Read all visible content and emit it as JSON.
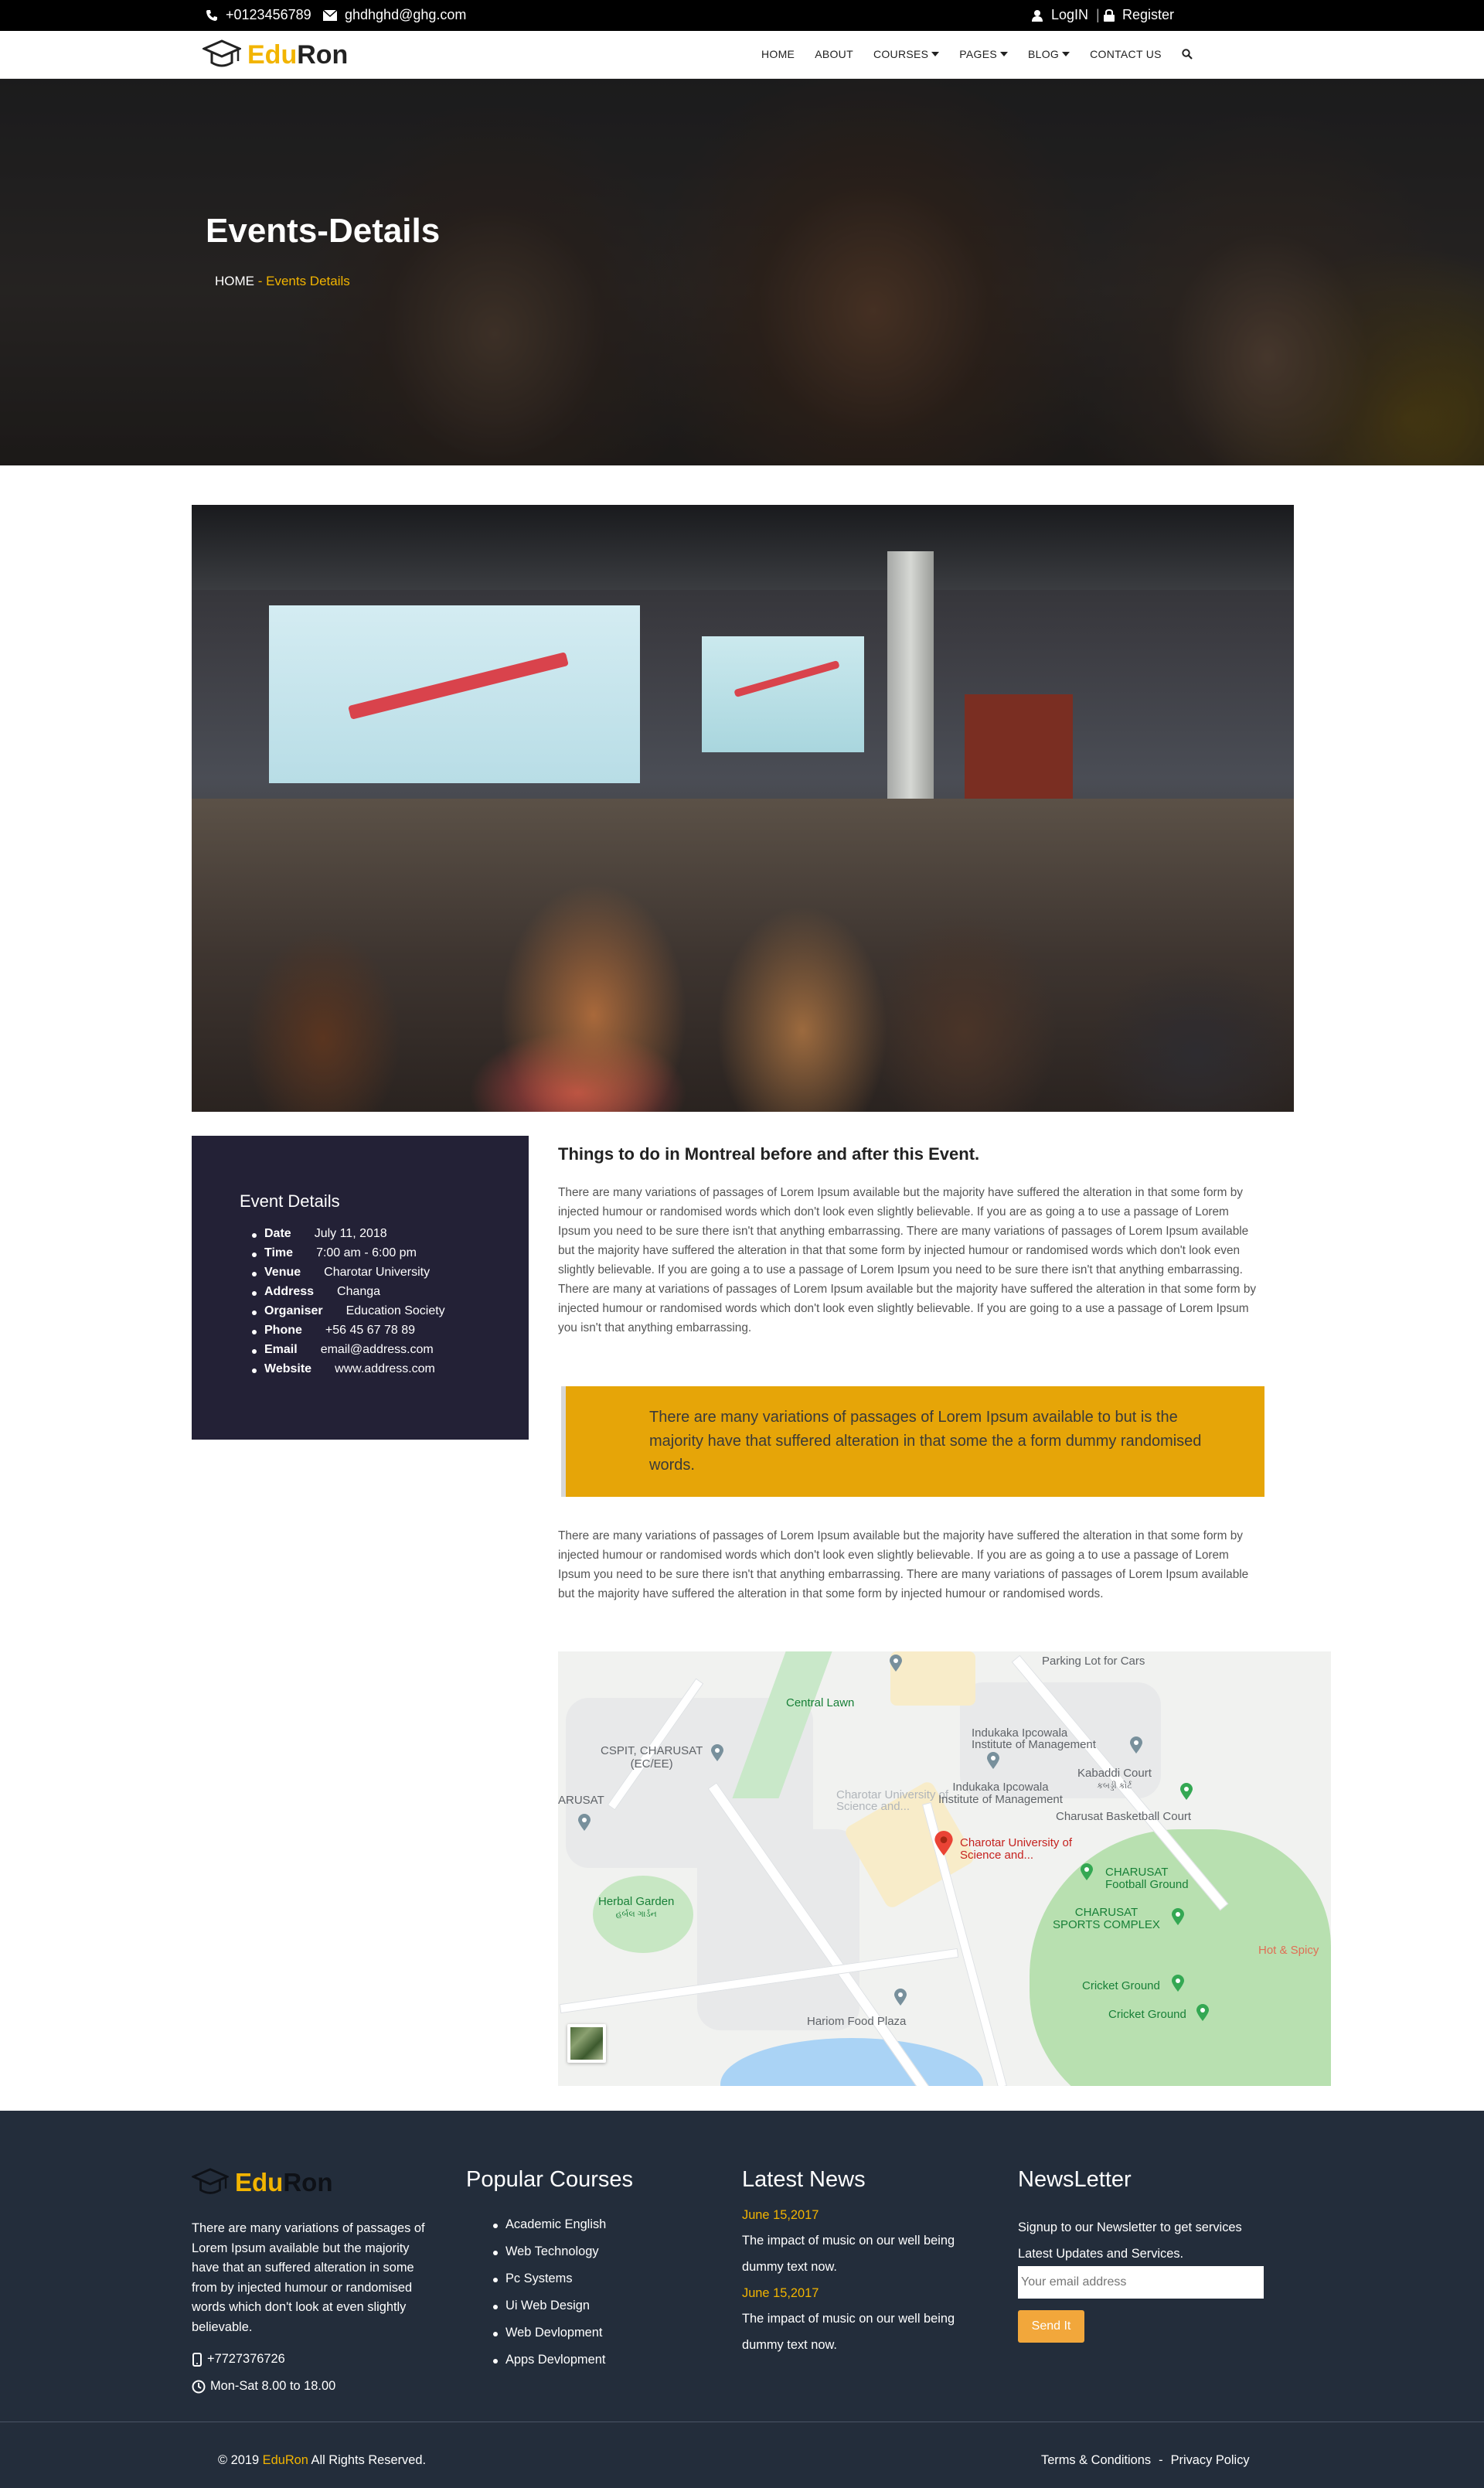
{
  "topbar": {
    "phone": "+0123456789",
    "email": "ghdhghd@ghg.com",
    "login": "LogIN",
    "separator": "|",
    "register": "Register"
  },
  "nav": {
    "brand_part1": "Edu",
    "brand_part2": "Ron",
    "items": [
      {
        "label": "HOME",
        "dropdown": false
      },
      {
        "label": "ABOUT",
        "dropdown": false
      },
      {
        "label": "COURSES",
        "dropdown": true
      },
      {
        "label": "PAGES",
        "dropdown": true
      },
      {
        "label": "BLOG",
        "dropdown": true
      },
      {
        "label": "CONTACT US",
        "dropdown": false
      }
    ]
  },
  "hero": {
    "title": "Events-Details",
    "breadcrumb_home": "HOME",
    "breadcrumb_sep": " - ",
    "breadcrumb_current": "Events Details"
  },
  "event_details": {
    "title": "Event Details",
    "rows": [
      {
        "key": "Date",
        "value": "July 11, 2018"
      },
      {
        "key": "Time",
        "value": "7:00 am - 6:00 pm"
      },
      {
        "key": "Venue",
        "value": "Charotar University"
      },
      {
        "key": "Address",
        "value": "Changa"
      },
      {
        "key": "Organiser",
        "value": "Education Society"
      },
      {
        "key": "Phone",
        "value": "+56 45 67 78 89"
      },
      {
        "key": "Email",
        "value": "email@address.com"
      },
      {
        "key": "Website",
        "value": "www.address.com"
      }
    ]
  },
  "content": {
    "title": "Things to do in Montreal before and after this Event.",
    "para1": "There are many variations of passages of Lorem Ipsum available but the majority have suffered the alteration in that some form by injected humour or randomised words which don't look even slightly believable. If you are as going a to use a passage of Lorem Ipsum you need to be sure there isn't that anything embarrassing. There are many variations of passages of Lorem Ipsum available but the majority have suffered the alteration in that that some form by injected humour or randomised words which don't look even slightly believable. If you are going a to use a passage of Lorem Ipsum you need to be sure there isn't that anything embarrassing. There are many at variations of passages of Lorem Ipsum available but the majority have suffered the alteration in that some form by injected humour or randomised words which don't look even slightly believable. If you are going to a use a passage of Lorem Ipsum you isn't that anything embarrassing.",
    "quote": "There are many variations of passages of Lorem Ipsum available to but is the majority have that suffered alteration in that some the a form dummy randomised words.",
    "para2": "There are many variations of passages of Lorem Ipsum available but the majority have suffered the alteration in that some form by injected humour or randomised words which don't look even slightly believable. If you are as going a to use a passage of Lorem Ipsum you need to be sure there isn't that anything embarrassing. There are many variations of passages of Lorem Ipsum available but the majority have suffered the alteration in that some form by injected humour or randomised words."
  },
  "map": {
    "labels": {
      "parking": "Parking Lot for Cars",
      "central_lawn": "Central Lawn",
      "indukaka1": "Indukaka Ipcowala",
      "indukaka1b": "Institute of Management",
      "cspit1": "CSPIT, CHARUSAT",
      "cspit2": "(EC/EE)",
      "kabaddi1": "Kabaddi Court",
      "kabaddi2": "કબડ્ડી કોર્ટ",
      "basketball": "Charusat Basketball Court",
      "arusat": "ARUSAT",
      "charotar_sci": "Charotar University of",
      "charotar_sci2": "Science and...",
      "indukaka2": "Indukaka Ipcowala",
      "indukaka2b": "Institute of Management",
      "charotar_faded": "Charotar University of",
      "charotar_faded2": "Science and...",
      "football1": "CHARUSAT",
      "football2": "Football Ground",
      "sports1": "CHARUSAT",
      "sports2": "SPORTS COMPLEX",
      "herbal1": "Herbal Garden",
      "herbal2": "હર્બલ ગાર્ડન",
      "hot_spicy": "Hot & Spicy",
      "cricket1": "Cricket Ground",
      "cricket2": "Cricket Ground",
      "food_plaza": "Hariom Food Plaza"
    }
  },
  "footer": {
    "brand_part1": "Edu",
    "brand_part2": "Ron",
    "description": "There are many variations of passages of Lorem Ipsum available but the majority have that an suffered alteration in some from by injected humour or randomised words which don't look at even slightly believable.",
    "phone": "+7727376726",
    "hours": "Mon-Sat 8.00 to 18.00",
    "courses_title": "Popular Courses",
    "courses": [
      "Academic English",
      "Web Technology",
      "Pc Systems",
      "Ui Web Design",
      "Web Devlopment",
      "Apps Devlopment"
    ],
    "news_title": "Latest News",
    "news": [
      {
        "date": "June 15,2017",
        "text": "The impact of music on our well being dummy text now."
      },
      {
        "date": "June 15,2017",
        "text": "The impact of music on our well being dummy text now."
      }
    ],
    "newsletter_title": "NewsLetter",
    "newsletter_text": "Signup to our Newsletter to get services Latest Updates and Services.",
    "email_placeholder": "Your email address",
    "send_label": "Send It",
    "copyright_prefix": "© 2019 ",
    "copyright_brand": "EduRon",
    "copyright_suffix": " All Rights Reserved.",
    "terms": "Terms & Conditions",
    "legal_sep": "-",
    "privacy": "Privacy Policy"
  },
  "colors": {
    "accent": "#f2b400",
    "quote_bg": "#e6a508",
    "sidebar_bg": "#232136",
    "footer_bg": "#232d3b",
    "send_button": "#f2a73b"
  }
}
